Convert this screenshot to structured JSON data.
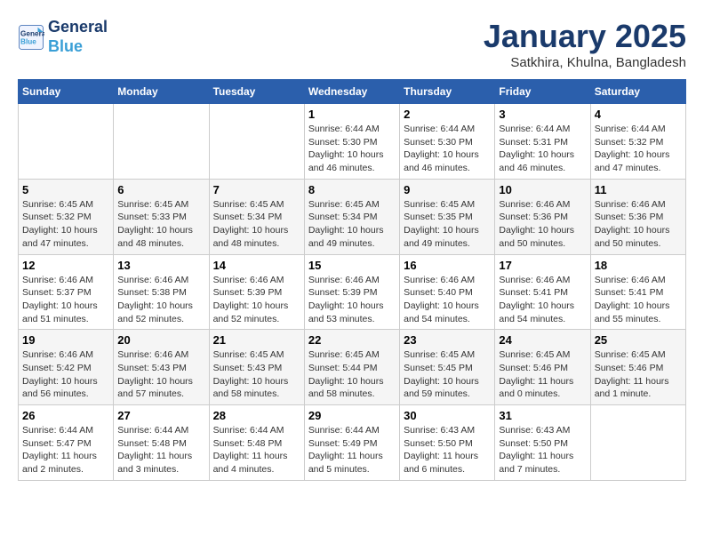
{
  "logo": {
    "line1": "General",
    "line2": "Blue"
  },
  "title": "January 2025",
  "subtitle": "Satkhira, Khulna, Bangladesh",
  "days_of_week": [
    "Sunday",
    "Monday",
    "Tuesday",
    "Wednesday",
    "Thursday",
    "Friday",
    "Saturday"
  ],
  "weeks": [
    [
      {
        "day": "",
        "info": ""
      },
      {
        "day": "",
        "info": ""
      },
      {
        "day": "",
        "info": ""
      },
      {
        "day": "1",
        "info": "Sunrise: 6:44 AM\nSunset: 5:30 PM\nDaylight: 10 hours and 46 minutes."
      },
      {
        "day": "2",
        "info": "Sunrise: 6:44 AM\nSunset: 5:30 PM\nDaylight: 10 hours and 46 minutes."
      },
      {
        "day": "3",
        "info": "Sunrise: 6:44 AM\nSunset: 5:31 PM\nDaylight: 10 hours and 46 minutes."
      },
      {
        "day": "4",
        "info": "Sunrise: 6:44 AM\nSunset: 5:32 PM\nDaylight: 10 hours and 47 minutes."
      }
    ],
    [
      {
        "day": "5",
        "info": "Sunrise: 6:45 AM\nSunset: 5:32 PM\nDaylight: 10 hours and 47 minutes."
      },
      {
        "day": "6",
        "info": "Sunrise: 6:45 AM\nSunset: 5:33 PM\nDaylight: 10 hours and 48 minutes."
      },
      {
        "day": "7",
        "info": "Sunrise: 6:45 AM\nSunset: 5:34 PM\nDaylight: 10 hours and 48 minutes."
      },
      {
        "day": "8",
        "info": "Sunrise: 6:45 AM\nSunset: 5:34 PM\nDaylight: 10 hours and 49 minutes."
      },
      {
        "day": "9",
        "info": "Sunrise: 6:45 AM\nSunset: 5:35 PM\nDaylight: 10 hours and 49 minutes."
      },
      {
        "day": "10",
        "info": "Sunrise: 6:46 AM\nSunset: 5:36 PM\nDaylight: 10 hours and 50 minutes."
      },
      {
        "day": "11",
        "info": "Sunrise: 6:46 AM\nSunset: 5:36 PM\nDaylight: 10 hours and 50 minutes."
      }
    ],
    [
      {
        "day": "12",
        "info": "Sunrise: 6:46 AM\nSunset: 5:37 PM\nDaylight: 10 hours and 51 minutes."
      },
      {
        "day": "13",
        "info": "Sunrise: 6:46 AM\nSunset: 5:38 PM\nDaylight: 10 hours and 52 minutes."
      },
      {
        "day": "14",
        "info": "Sunrise: 6:46 AM\nSunset: 5:39 PM\nDaylight: 10 hours and 52 minutes."
      },
      {
        "day": "15",
        "info": "Sunrise: 6:46 AM\nSunset: 5:39 PM\nDaylight: 10 hours and 53 minutes."
      },
      {
        "day": "16",
        "info": "Sunrise: 6:46 AM\nSunset: 5:40 PM\nDaylight: 10 hours and 54 minutes."
      },
      {
        "day": "17",
        "info": "Sunrise: 6:46 AM\nSunset: 5:41 PM\nDaylight: 10 hours and 54 minutes."
      },
      {
        "day": "18",
        "info": "Sunrise: 6:46 AM\nSunset: 5:41 PM\nDaylight: 10 hours and 55 minutes."
      }
    ],
    [
      {
        "day": "19",
        "info": "Sunrise: 6:46 AM\nSunset: 5:42 PM\nDaylight: 10 hours and 56 minutes."
      },
      {
        "day": "20",
        "info": "Sunrise: 6:46 AM\nSunset: 5:43 PM\nDaylight: 10 hours and 57 minutes."
      },
      {
        "day": "21",
        "info": "Sunrise: 6:45 AM\nSunset: 5:43 PM\nDaylight: 10 hours and 58 minutes."
      },
      {
        "day": "22",
        "info": "Sunrise: 6:45 AM\nSunset: 5:44 PM\nDaylight: 10 hours and 58 minutes."
      },
      {
        "day": "23",
        "info": "Sunrise: 6:45 AM\nSunset: 5:45 PM\nDaylight: 10 hours and 59 minutes."
      },
      {
        "day": "24",
        "info": "Sunrise: 6:45 AM\nSunset: 5:46 PM\nDaylight: 11 hours and 0 minutes."
      },
      {
        "day": "25",
        "info": "Sunrise: 6:45 AM\nSunset: 5:46 PM\nDaylight: 11 hours and 1 minute."
      }
    ],
    [
      {
        "day": "26",
        "info": "Sunrise: 6:44 AM\nSunset: 5:47 PM\nDaylight: 11 hours and 2 minutes."
      },
      {
        "day": "27",
        "info": "Sunrise: 6:44 AM\nSunset: 5:48 PM\nDaylight: 11 hours and 3 minutes."
      },
      {
        "day": "28",
        "info": "Sunrise: 6:44 AM\nSunset: 5:48 PM\nDaylight: 11 hours and 4 minutes."
      },
      {
        "day": "29",
        "info": "Sunrise: 6:44 AM\nSunset: 5:49 PM\nDaylight: 11 hours and 5 minutes."
      },
      {
        "day": "30",
        "info": "Sunrise: 6:43 AM\nSunset: 5:50 PM\nDaylight: 11 hours and 6 minutes."
      },
      {
        "day": "31",
        "info": "Sunrise: 6:43 AM\nSunset: 5:50 PM\nDaylight: 11 hours and 7 minutes."
      },
      {
        "day": "",
        "info": ""
      }
    ]
  ]
}
